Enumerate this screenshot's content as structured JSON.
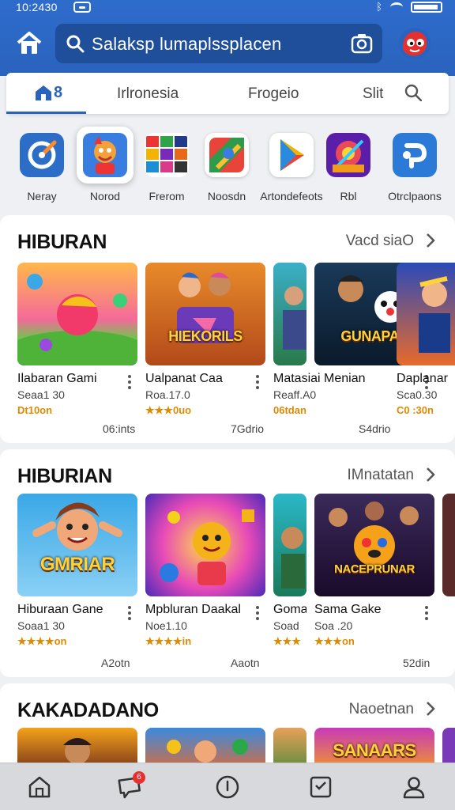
{
  "status_bar": {
    "time": "10:2430"
  },
  "search": {
    "text": "Salaksp lumaplssplacen"
  },
  "tabs": [
    {
      "label": "Irlronesia"
    },
    {
      "label": "Frogeio"
    },
    {
      "label": "Slit"
    }
  ],
  "tab_home_suffix": "8",
  "categories": [
    {
      "label": "Neray",
      "icon": "compass-icon"
    },
    {
      "label": "Norod",
      "icon": "mascot-icon"
    },
    {
      "label": "Frerom",
      "icon": "puzzle-grid-icon"
    },
    {
      "label": "Noosdn",
      "icon": "maps-icon"
    },
    {
      "label": "Artondefeots",
      "icon": "play-store-icon"
    },
    {
      "label": "Rbl",
      "icon": "game-art-icon"
    },
    {
      "label": "Otrclpaons",
      "icon": "brand-icon"
    }
  ],
  "sections": [
    {
      "title": "HIBURAN",
      "more": "Vacd siaO",
      "cards": [
        {
          "name": "Ilabaran Gami",
          "sub": "Seaa1 30",
          "rate": "Dt10on",
          "size": "06:ints"
        },
        {
          "name": "Ualpanat Caa",
          "sub": "Roa.17.0",
          "rate": "★★★0uo",
          "size": "7Gdrio"
        },
        {
          "name": "Matasiai Menian",
          "sub": "Reaff.A0",
          "rate": "06tdan",
          "size": "S4drio"
        },
        {
          "name": "Daplanar",
          "sub": "Sca0.30",
          "rate": "C0 :30n",
          "size": ""
        }
      ]
    },
    {
      "title": "HIBURIAN",
      "more": "IMnatatan",
      "cards": [
        {
          "name": "Hiburaan Gane",
          "sub": "Soaa1 30",
          "rate": "★★★★on",
          "size": "A2otn"
        },
        {
          "name": "Mpbluran Daakal",
          "sub": "Noe1.10",
          "rate": "★★★★in",
          "size": "Aaotn"
        },
        {
          "name": "Goma",
          "sub": "Soad",
          "rate": "★★★",
          "size": ""
        },
        {
          "name": "Sama Gake",
          "sub": "Soa .20",
          "rate": "★★★on",
          "size": "52din"
        }
      ]
    },
    {
      "title": "KAKADADANO",
      "more": "Naoetnan",
      "cards": []
    }
  ],
  "thumb_text": {
    "s1c2": "HIEKORILS",
    "s1c4": "GUNAPAS",
    "s2c1": "GMRIAR",
    "s2c4": "NACEPRUNAR",
    "s3c4": "SANAARS"
  },
  "badge_count": "6",
  "colors": {
    "primary": "#2a63bd",
    "search_bg": "#1f4e9a",
    "rating": "#e08a00"
  }
}
